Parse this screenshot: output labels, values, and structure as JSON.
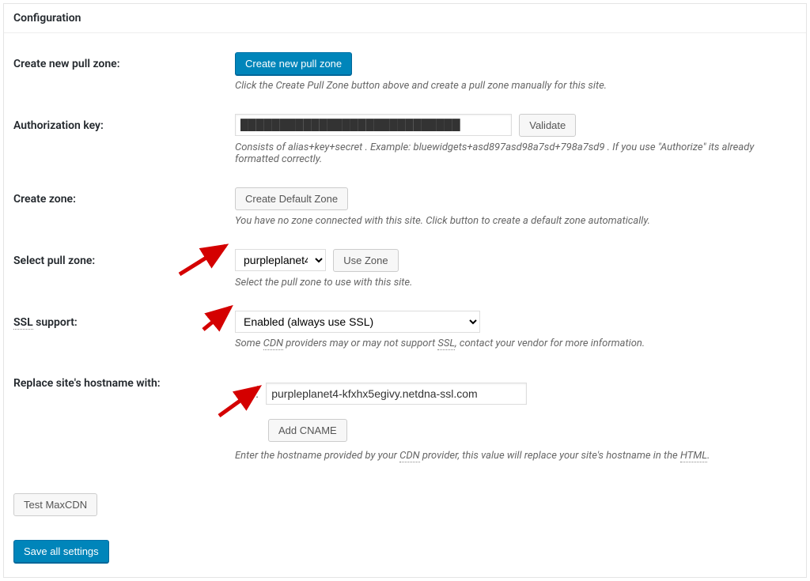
{
  "header": {
    "title": "Configuration"
  },
  "rows": {
    "createPullZone": {
      "label": "Create new pull zone:",
      "button": "Create new pull zone",
      "desc": "Click the Create Pull Zone button above and create a pull zone manually for this site."
    },
    "authKey": {
      "label": "Authorization key:",
      "value": "████████████████████████████",
      "validate": "Validate",
      "desc": "Consists of alias+key+secret . Example: bluewidgets+asd897asd98a7sd+798a7sd9 . If you use \"Authorize\" its already formatted correctly."
    },
    "createZone": {
      "label": "Create zone:",
      "button": "Create Default Zone",
      "desc": "You have no zone connected with this site. Click button to create a default zone automatically."
    },
    "selectZone": {
      "label": "Select pull zone:",
      "selected": "purpleplanet4",
      "useZone": "Use Zone",
      "desc": "Select the pull zone to use with this site."
    },
    "ssl": {
      "label_plain": " support:",
      "label_acronym": "SSL",
      "selected": "Enabled (always use SSL)",
      "desc_a": "Some ",
      "desc_b": " providers may or may not support ",
      "desc_c": ", contact your vendor for more information.",
      "acr_cdn": "CDN",
      "acr_ssl": "SSL"
    },
    "hostname": {
      "label": "Replace site's hostname with:",
      "num": "1.",
      "value": "purpleplanet4-kfxhx5egivy.netdna-ssl.com",
      "addCname": "Add CNAME",
      "desc_a": "Enter the hostname provided by your ",
      "desc_b": " provider, this value will replace your site's hostname in the ",
      "desc_c": ".",
      "acr_cdn": "CDN",
      "acr_html": "HTML"
    }
  },
  "buttons": {
    "test": "Test MaxCDN",
    "save": "Save all settings"
  }
}
